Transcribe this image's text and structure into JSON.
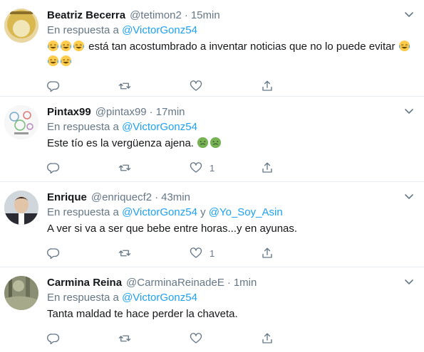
{
  "tweets": [
    {
      "name": "Beatriz Becerra",
      "handle": "@tetimon2",
      "separator": "·",
      "time": "15min",
      "reply_prefix": "En respuesta a",
      "mentions": [
        "@VictorGonz54"
      ],
      "text": "está tan acostumbrado a inventar noticias que no lo puede evitar",
      "emoji_before": "face-with-tears-of-joy",
      "emoji_after": "face-with-tears-of-joy",
      "likes": ""
    },
    {
      "name": "Pintax99",
      "handle": "@pintax99",
      "separator": "·",
      "time": "17min",
      "reply_prefix": "En respuesta a",
      "mentions": [
        "@VictorGonz54"
      ],
      "text": "Este tío es la vergüenza ajena.",
      "emoji_after": "nauseated-face",
      "likes": "1"
    },
    {
      "name": "Enrique",
      "handle": "@enriquecf2",
      "separator": "·",
      "time": "43min",
      "reply_prefix": "En respuesta a",
      "mentions": [
        "@VictorGonz54",
        "@Yo_Soy_Asin"
      ],
      "mention_joiner": "y",
      "text": "A ver si va a ser que bebe entre horas...y en ayunas.",
      "likes": "1"
    },
    {
      "name": "Carmina Reina",
      "handle": "@CarminaReinadeE",
      "separator": "·",
      "time": "1min",
      "reply_prefix": "En respuesta a",
      "mentions": [
        "@VictorGonz54"
      ],
      "text": "Tanta maldad te hace perder la chaveta.",
      "likes": ""
    }
  ],
  "colors": {
    "link": "#1da1f2",
    "secondary_text": "#657786",
    "divider": "#e6ecf0",
    "icon": "#657786"
  },
  "icons": [
    "reply-icon",
    "retweet-icon",
    "like-icon",
    "share-icon",
    "chevron-down-icon"
  ]
}
